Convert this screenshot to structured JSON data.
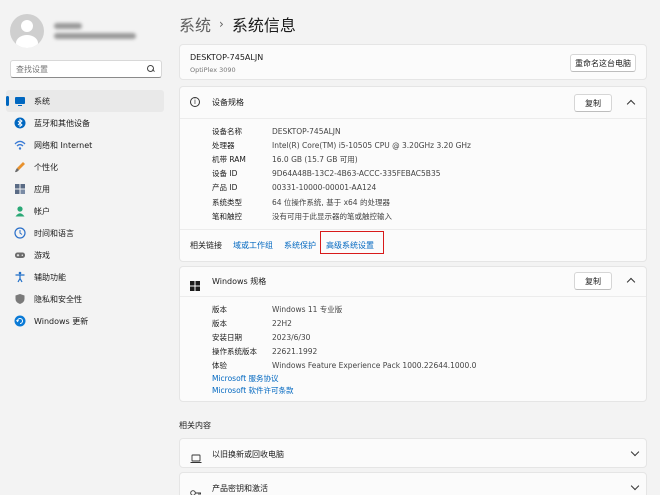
{
  "sidebar": {
    "search_placeholder": "查找设置",
    "items": [
      {
        "label": "系统",
        "icon": "system-icon",
        "active": true
      },
      {
        "label": "蓝牙和其他设备",
        "icon": "bluetooth-icon"
      },
      {
        "label": "网络和 Internet",
        "icon": "wifi-icon"
      },
      {
        "label": "个性化",
        "icon": "brush-icon"
      },
      {
        "label": "应用",
        "icon": "apps-icon"
      },
      {
        "label": "帐户",
        "icon": "account-icon"
      },
      {
        "label": "时间和语言",
        "icon": "globe-clock-icon"
      },
      {
        "label": "游戏",
        "icon": "gamepad-icon"
      },
      {
        "label": "辅助功能",
        "icon": "accessibility-icon"
      },
      {
        "label": "隐私和安全性",
        "icon": "shield-icon"
      },
      {
        "label": "Windows 更新",
        "icon": "update-icon"
      }
    ]
  },
  "breadcrumb": {
    "parent": "系统",
    "separator": "›",
    "current": "系统信息"
  },
  "device_header": {
    "name": "DESKTOP-745ALJN",
    "model": "OptiPlex 3090",
    "rename_button": "重命名这台电脑"
  },
  "device_specs": {
    "title": "设备规格",
    "copy_button": "复制",
    "rows": [
      {
        "key": "设备名称",
        "value": "DESKTOP-745ALJN"
      },
      {
        "key": "处理器",
        "value": "Intel(R) Core(TM) i5-10505 CPU @ 3.20GHz   3.20 GHz"
      },
      {
        "key": "机带 RAM",
        "value": "16.0 GB (15.7 GB 可用)"
      },
      {
        "key": "设备 ID",
        "value": "9D64A48B-13C2-4B63-ACCC-335FEBAC5B35"
      },
      {
        "key": "产品 ID",
        "value": "00331-10000-00001-AA124"
      },
      {
        "key": "系统类型",
        "value": "64 位操作系统, 基于 x64 的处理器"
      },
      {
        "key": "笔和触控",
        "value": "没有可用于此显示器的笔或触控输入"
      }
    ]
  },
  "related_links": {
    "label": "相关链接",
    "links": [
      "域或工作组",
      "系统保护",
      "高级系统设置"
    ]
  },
  "windows_specs": {
    "title": "Windows 规格",
    "copy_button": "复制",
    "rows": [
      {
        "key": "版本",
        "value": "Windows 11 专业版"
      },
      {
        "key": "版本",
        "value": "22H2"
      },
      {
        "key": "安装日期",
        "value": "2023/6/30"
      },
      {
        "key": "操作系统版本",
        "value": "22621.1992"
      },
      {
        "key": "体验",
        "value": "Windows Feature Experience Pack 1000.22644.1000.0"
      }
    ],
    "links": [
      "Microsoft 服务协议",
      "Microsoft 软件许可条款"
    ]
  },
  "related_content": {
    "title": "相关内容",
    "items": [
      {
        "label": "以旧换新或回收电脑"
      },
      {
        "label": "产品密钥和激活"
      }
    ]
  },
  "colors": {
    "accent": "#0067c0",
    "highlight_box": "#d81a1a"
  }
}
